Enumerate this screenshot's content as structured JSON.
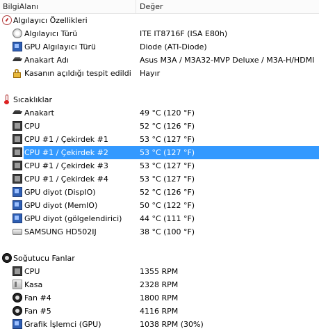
{
  "columns": {
    "field": "BilgiAlanı",
    "value": "Değer"
  },
  "sections": [
    {
      "title": "Algılayıcı Özellikleri",
      "icon": "gauge-icon",
      "items": [
        {
          "label": "Algılayıcı Türü",
          "value": "ITE IT8716F  (ISA E80h)",
          "icon": "sensor-icon"
        },
        {
          "label": "GPU Algılayıcı Türü",
          "value": "Diode  (ATI-Diode)",
          "icon": "gpu-icon"
        },
        {
          "label": "Anakart Adı",
          "value": "Asus M3A / M3A32-MVP Deluxe / M3A-H/HDMI",
          "icon": "motherboard-icon"
        },
        {
          "label": "Kasanın açıldığı tespit edildi",
          "value": "Hayır",
          "icon": "lock-icon"
        }
      ]
    },
    {
      "title": "Sıcaklıklar",
      "icon": "thermometer-icon",
      "items": [
        {
          "label": "Anakart",
          "value": "49 °C  (120 °F)",
          "icon": "motherboard-icon"
        },
        {
          "label": "CPU",
          "value": "52 °C  (126 °F)",
          "icon": "cpu-icon"
        },
        {
          "label": "CPU #1 / Çekirdek #1",
          "value": "53 °C  (127 °F)",
          "icon": "cpu-icon"
        },
        {
          "label": "CPU #1 / Çekirdek #2",
          "value": "53 °C  (127 °F)",
          "icon": "cpu-icon",
          "selected": true
        },
        {
          "label": "CPU #1 / Çekirdek #3",
          "value": "53 °C  (127 °F)",
          "icon": "cpu-icon"
        },
        {
          "label": "CPU #1 / Çekirdek #4",
          "value": "53 °C  (127 °F)",
          "icon": "cpu-icon"
        },
        {
          "label": "GPU diyot (DispIO)",
          "value": "52 °C  (126 °F)",
          "icon": "gpu-icon"
        },
        {
          "label": "GPU diyot (MemIO)",
          "value": "50 °C  (122 °F)",
          "icon": "gpu-icon"
        },
        {
          "label": "GPU diyot (gölgelendirici)",
          "value": "44 °C  (111 °F)",
          "icon": "gpu-icon"
        },
        {
          "label": "SAMSUNG HD502IJ",
          "value": "38 °C  (100 °F)",
          "icon": "hard-disk-icon"
        }
      ]
    },
    {
      "title": "Soğutucu Fanlar",
      "icon": "fan-icon",
      "items": [
        {
          "label": "CPU",
          "value": "1355 RPM",
          "icon": "cpu-icon"
        },
        {
          "label": "Kasa",
          "value": "2328 RPM",
          "icon": "case-icon"
        },
        {
          "label": "Fan #4",
          "value": "1800 RPM",
          "icon": "fan-icon"
        },
        {
          "label": "Fan #5",
          "value": "4116 RPM",
          "icon": "fan-icon"
        },
        {
          "label": "Grafik İşlemci (GPU)",
          "value": "1038 RPM  (30%)",
          "icon": "gpu-icon"
        }
      ]
    }
  ],
  "colors": {
    "selection": "#3399ff",
    "header_bg": "#fbfbfb"
  }
}
